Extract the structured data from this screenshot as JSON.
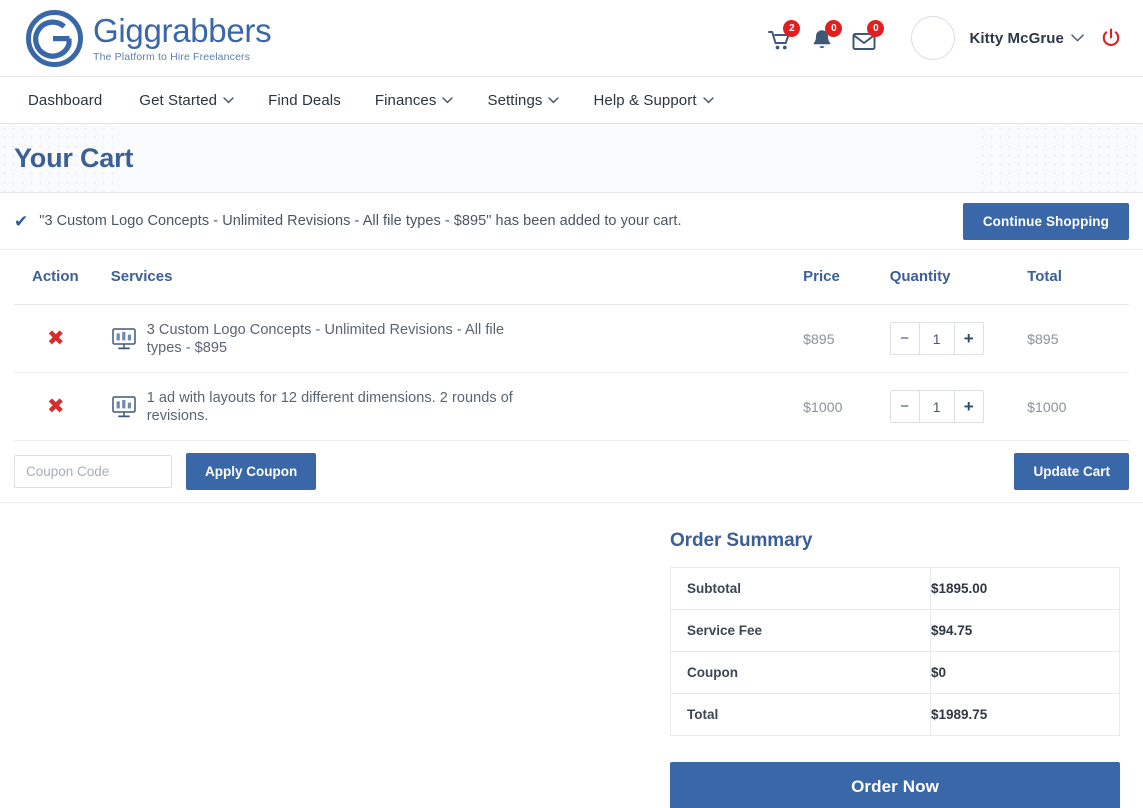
{
  "brand": {
    "name": "Giggrabbers",
    "tagline": "The Platform to Hire Freelancers",
    "logo_color": "#3a67a8"
  },
  "header": {
    "notifications": [
      {
        "icon": "cart-icon",
        "count": "2"
      },
      {
        "icon": "bell-icon",
        "count": "0"
      },
      {
        "icon": "envelope-icon",
        "count": "0"
      }
    ],
    "user_name": "Kitty McGrue",
    "caret": "⌄",
    "power_icon": "power-icon",
    "badge_color": "#e02020"
  },
  "nav": {
    "items": [
      {
        "label": "Dashboard",
        "has_caret": false
      },
      {
        "label": "Get Started",
        "has_caret": true
      },
      {
        "label": "Find Deals",
        "has_caret": false
      },
      {
        "label": "Finances",
        "has_caret": true
      },
      {
        "label": "Settings",
        "has_caret": true
      },
      {
        "label": "Help & Support",
        "has_caret": true
      }
    ],
    "caret": "⌄"
  },
  "banner": {
    "title": "Your Cart"
  },
  "alert": {
    "check": "✔",
    "message": "\"3 Custom Logo Concepts - Unlimited Revisions - All file types - $895\" has been added to your cart.",
    "continue_label": "Continue Shopping"
  },
  "cart": {
    "headers": {
      "action": "Action",
      "services": "Services",
      "price": "Price",
      "quantity": "Quantity",
      "total": "Total"
    },
    "remove_glyph": "✖",
    "minus": "−",
    "plus": "+",
    "rows": [
      {
        "icon": "monitor-chart-icon",
        "name": "3 Custom Logo Concepts - Unlimited Revisions - All file types - $895",
        "price": "$895",
        "quantity": "1",
        "total": "$895"
      },
      {
        "icon": "monitor-chart-icon",
        "name": "1 ad with layouts for 12 different dimensions. 2 rounds of revisions.",
        "price": "$1000",
        "quantity": "1",
        "total": "$1000"
      }
    ]
  },
  "coupon": {
    "placeholder": "Coupon Code",
    "value": "",
    "apply_label": "Apply Coupon",
    "update_label": "Update Cart"
  },
  "summary": {
    "title": "Order Summary",
    "rows": [
      {
        "label": "Subtotal",
        "value": "$1895.00"
      },
      {
        "label": "Service Fee",
        "value": "$94.75"
      },
      {
        "label": "Coupon",
        "value": "$0"
      },
      {
        "label": "Total",
        "value": "$1989.75"
      }
    ],
    "order_label": "Order Now"
  },
  "colors": {
    "primary": "#3a67a8",
    "heading": "#3c5f96",
    "danger": "#d32f2f"
  }
}
